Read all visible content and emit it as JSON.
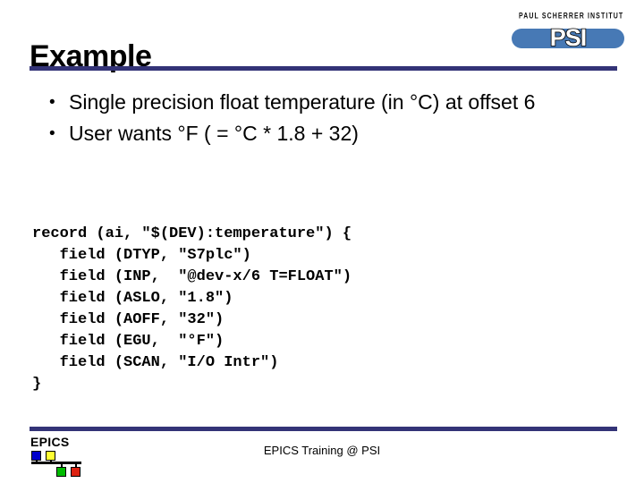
{
  "slide": {
    "title": "Example",
    "bullets": [
      "Single precision float temperature (in °C) at offset 6",
      "User wants °F ( = °C * 1.8 + 32)"
    ],
    "code": "record (ai, \"$(DEV):temperature\") {\n   field (DTYP, \"S7plc\")\n   field (INP,  \"@dev-x/6 T=FLOAT\")\n   field (ASLO, \"1.8\")\n   field (AOFF, \"32\")\n   field (EGU,  \"°F\")\n   field (SCAN, \"I/O Intr\")\n}",
    "footer_text": "EPICS Training @ PSI"
  },
  "psi_logo": {
    "wordmark": "PAUL SCHERRER INSTITUT",
    "letters": "PSI",
    "bar_color": "#4779b5"
  },
  "epics_logo": {
    "label": "EPICS",
    "square_colors": {
      "blue": "#0000cc",
      "yellow": "#ffff33",
      "green": "#00bb00",
      "red": "#dd2211"
    }
  },
  "theme": {
    "rule_color": "#333377",
    "background": "#ffffff",
    "text_color": "#000000"
  }
}
